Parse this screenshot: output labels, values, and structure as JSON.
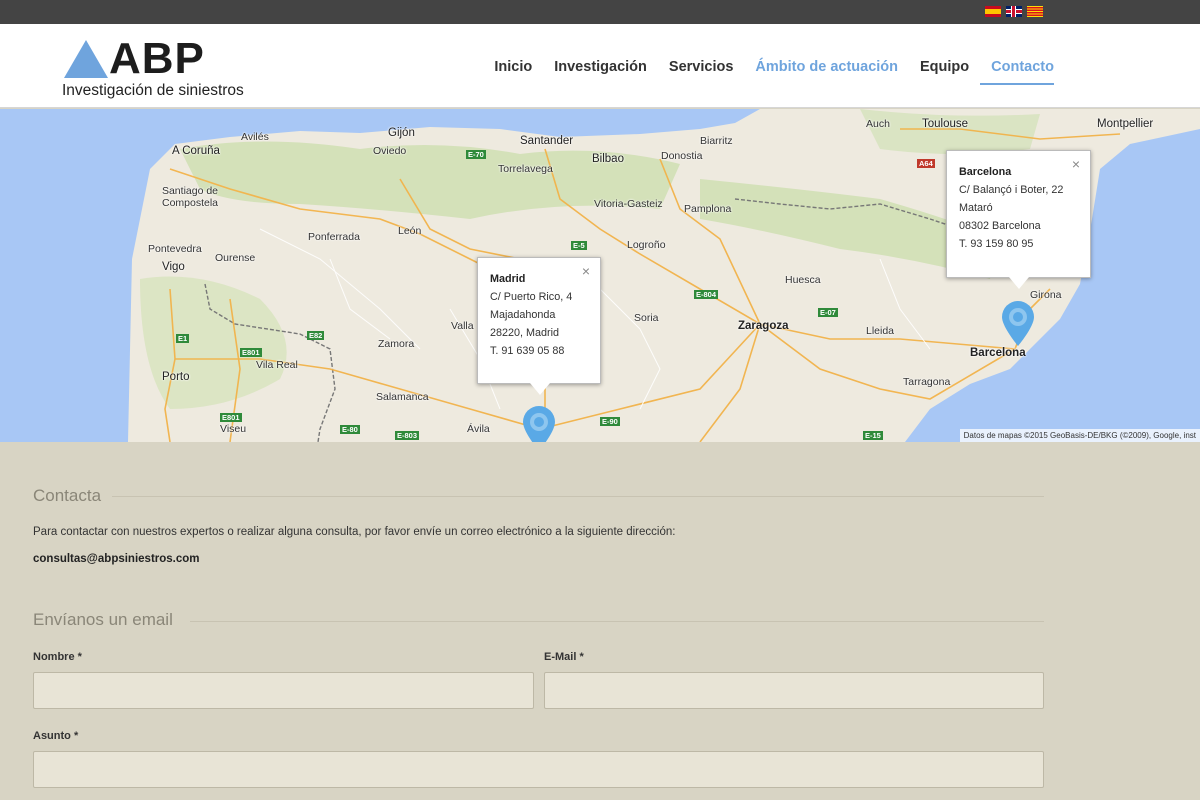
{
  "languages": [
    {
      "code": "es",
      "icon": "spain-flag-icon"
    },
    {
      "code": "en",
      "icon": "uk-flag-icon"
    },
    {
      "code": "ca",
      "icon": "catalonia-flag-icon"
    }
  ],
  "logo": {
    "text": "ABP",
    "subtitle": "Investigación de siniestros"
  },
  "nav": {
    "items": [
      {
        "label": "Inicio"
      },
      {
        "label": "Investigación"
      },
      {
        "label": "Servicios"
      },
      {
        "label": "Ámbito de actuación"
      },
      {
        "label": "Equipo"
      },
      {
        "label": "Contacto"
      }
    ],
    "active": "Contacto",
    "accent_color": "#6fa4dd"
  },
  "map": {
    "labels": [
      "Avilés",
      "Gijón",
      "Oviedo",
      "A Coruña",
      "Santander",
      "Torrelavega",
      "Bilbao",
      "Donostia",
      "Biarritz",
      "Toulouse",
      "Auch",
      "Montpellier",
      "Santiago de Compostela",
      "Vitoria-Gasteiz",
      "Pamplona",
      "Ponferrada",
      "León",
      "Logroño",
      "Pontevedra",
      "Vigo",
      "Ourense",
      "Huesca",
      "Zaragoza",
      "Lleida",
      "Girona",
      "Barcelona",
      "Tarragona",
      "Zamora",
      "Soria",
      "Vila Real",
      "Porto",
      "Salamanca",
      "Ávila",
      "Viseu",
      "Valla"
    ],
    "roads": [
      "E-70",
      "E-5",
      "E-804",
      "E-07",
      "E1",
      "E82",
      "E801",
      "E801",
      "E-80",
      "E-803",
      "E-90",
      "E-15",
      "A64"
    ],
    "attribution": "Datos de mapas ©2015 GeoBasis-DE/BKG (©2009), Google, inst",
    "popups": {
      "madrid": {
        "title": "Madrid",
        "line1": "C/ Puerto Rico, 4",
        "line2": "Majadahonda",
        "line3": "28220, Madrid",
        "line4": "T. 91 639 05 88"
      },
      "barcelona": {
        "title": "Barcelona",
        "line1": "C/ Balançó i Boter, 22",
        "line2": "Mataró",
        "line3": "08302 Barcelona",
        "line4": "T. 93 159 80 95"
      }
    },
    "pin_color": "#5aa9e6",
    "close_glyph": "×"
  },
  "contact": {
    "title": "Contacta",
    "text": "Para contactar con nuestros expertos o realizar alguna consulta, por favor envíe un correo electrónico a la siguiente dirección:",
    "email": "consultas@abpsiniestros.com"
  },
  "form": {
    "title": "Envíanos un email",
    "name_label": "Nombre *",
    "name_value": "",
    "email_label": "E-Mail *",
    "email_value": "",
    "subject_label": "Asunto *",
    "subject_value": ""
  }
}
